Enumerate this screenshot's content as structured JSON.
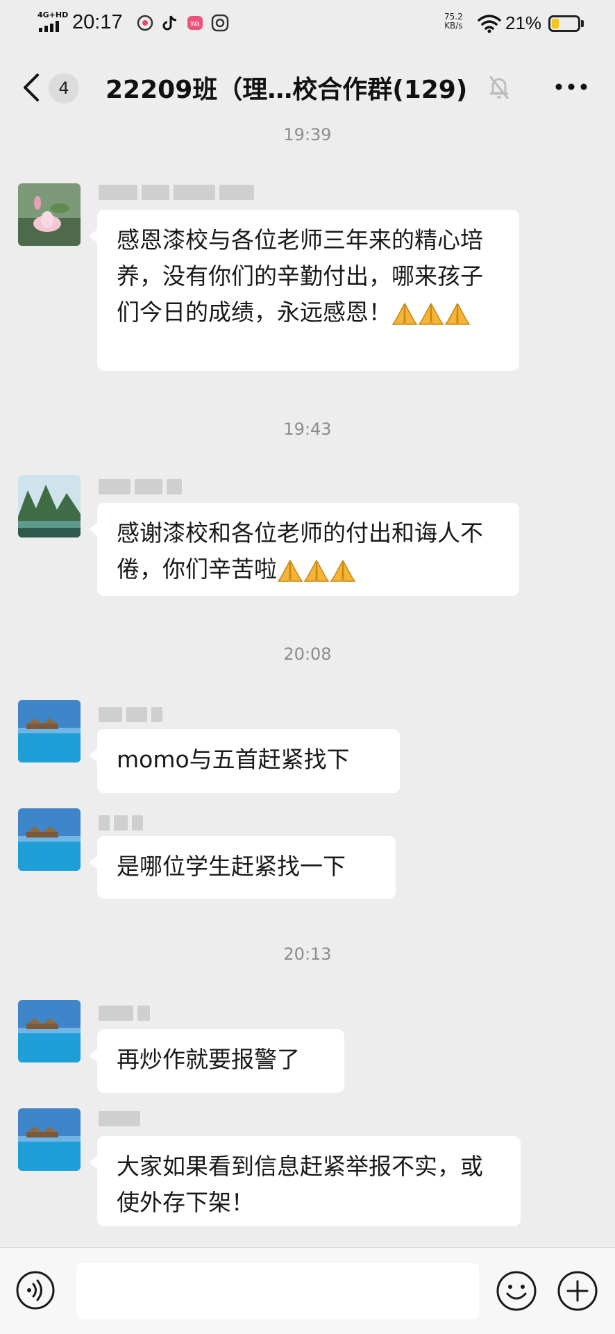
{
  "status_bar": {
    "network": "4G+HD",
    "time": "20:17",
    "speed_value": "75.2",
    "speed_unit": "KB/s",
    "battery": "21%",
    "battery_color": "#f5c518"
  },
  "header": {
    "back_icon": "chevron-left-icon",
    "unread_count": "4",
    "title": "22209班（理…校合作群(129)",
    "mute_icon": "bell-slash-icon",
    "more_icon": "more-dots-icon"
  },
  "messages": [
    {
      "time": "19:39",
      "text": "感恩漆校与各位老师三年来的精心培养，没有你们的辛勤付出，哪来孩子们今日的成绩，永远感恩！",
      "emoji_count": 3
    },
    {
      "time": "19:43",
      "text": "感谢漆校和各位老师的付出和诲人不倦，你们辛苦啦",
      "emoji_count": 3
    },
    {
      "time": "20:08",
      "text": "momo与五首赶紧找下",
      "emoji_count": 0
    },
    {
      "time": "",
      "text": "是哪位学生赶紧找一下",
      "emoji_count": 0
    },
    {
      "time": "20:13",
      "text": "再炒作就要报警了",
      "emoji_count": 0
    },
    {
      "time": "",
      "text": "大家如果看到信息赶紧举报不实，或使外存下架！",
      "emoji_count": 0
    }
  ],
  "input_bar": {
    "voice_icon": "voice-icon",
    "emoji_icon": "emoji-icon",
    "plus_icon": "plus-circle-icon",
    "accent_color": "#191919"
  }
}
